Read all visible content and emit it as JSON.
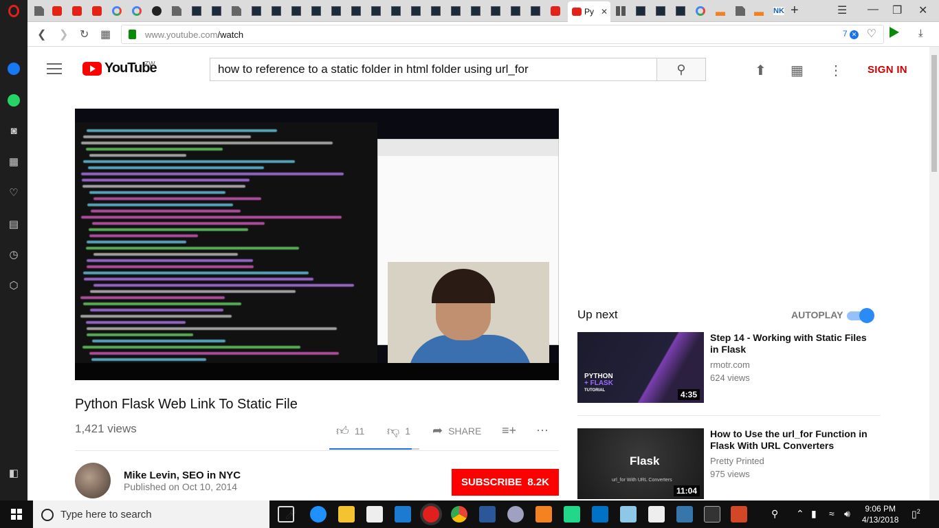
{
  "browser": {
    "active_tab_label": "Py",
    "url_host": "www.youtube.com",
    "url_path": "/watch",
    "url_badge": "7",
    "profile_initials": "NK"
  },
  "youtube": {
    "logo_text": "YouTube",
    "region_code": "ZW",
    "search_value": "how to reference to a static folder in html folder using url_for",
    "sign_in_label": "SIGN IN"
  },
  "video": {
    "title": "Python Flask Web Link To Static File",
    "views": "1,421 views",
    "likes": "11",
    "dislikes": "1",
    "like_ratio": 0.917,
    "share_label": "SHARE",
    "channel": "Mike Levin, SEO in NYC",
    "published": "Published on Oct 10, 2014",
    "subscribe_label": "SUBSCRIBE",
    "subscriber_count": "8.2K"
  },
  "up_next": {
    "label": "Up next",
    "autoplay_label": "AUTOPLAY",
    "autoplay_on": true,
    "items": [
      {
        "title": "Step 14 - Working with Static Files in Flask",
        "channel": "rmotr.com",
        "views": "624 views",
        "duration": "4:35",
        "thumb_line1": "PYTHON",
        "thumb_line2": "+ FLASK",
        "thumb_line3": "TUTORIAL"
      },
      {
        "title": "How to Use the url_for Function in Flask With URL Converters",
        "channel": "Pretty Printed",
        "views": "975 views",
        "duration": "11:04",
        "thumb_title": "Flask",
        "thumb_sub": "url_for With URL Converters"
      }
    ]
  },
  "taskbar": {
    "search_placeholder": "Type here to search",
    "time": "9:06 PM",
    "date": "4/13/2018",
    "notification_count": "2"
  },
  "colors": {
    "yt_red": "#ff0000",
    "link_blue": "#1a73e8",
    "opera_red": "#e0201f"
  }
}
